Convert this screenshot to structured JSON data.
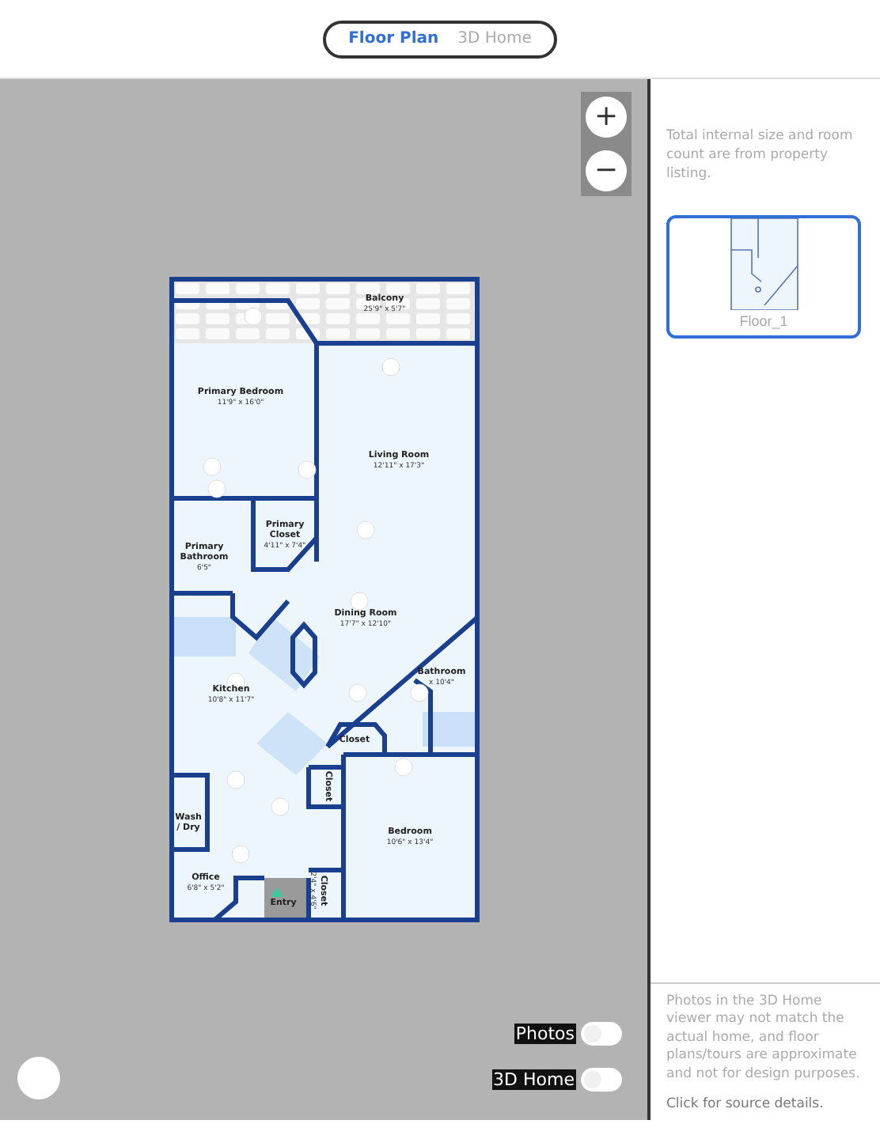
{
  "view_toggle": [
    {
      "label": "Floor Plan",
      "selected": true
    },
    {
      "label": "3D Home",
      "selected": false
    }
  ],
  "zoom_controls": [
    "+",
    "−"
  ],
  "plan": {
    "rooms": [
      {
        "name": "Balcony",
        "size": "25'9\" x 5'7\""
      },
      {
        "name": "Primary Bedroom",
        "size": "11'9\" x 16'0\""
      },
      {
        "name": "Living Room",
        "size": "12'11\" x 17'3\""
      },
      {
        "name": "Primary Closet",
        "size": "4'11\" x 7'4\""
      },
      {
        "name": "Primary Bathroom",
        "size": "6'5\""
      },
      {
        "name": "Dining Room",
        "size": "17'7\" x 12'10\""
      },
      {
        "name": "Kitchen",
        "size": "10'8\" x 11'7\""
      },
      {
        "name": "Bathroom",
        "size": "x 10'4\""
      },
      {
        "name": "Closet"
      },
      {
        "name": "Closet"
      },
      {
        "name": "Bedroom",
        "size": "10'6\" x 13'4\""
      },
      {
        "name": "Wash / Dry"
      },
      {
        "name": "Office",
        "size": "6'8\" x 5'2\""
      },
      {
        "name": "Closet",
        "size": "2'4\" x 4'6\""
      },
      {
        "name": "Entry"
      }
    ]
  },
  "overlay_toggles": [
    {
      "label": "Photos",
      "on": false
    },
    {
      "label": "3D Home",
      "on": false
    }
  ],
  "sidebar": {
    "note": "Total internal size and room count are from property listing.",
    "floors": [
      {
        "label": "Floor_1",
        "selected": true
      }
    ],
    "disclaimer": "Photos in the 3D Home viewer may not match the actual home, and floor plans/tours are approximate and not for design purposes.",
    "source_link": "Click for source details."
  }
}
